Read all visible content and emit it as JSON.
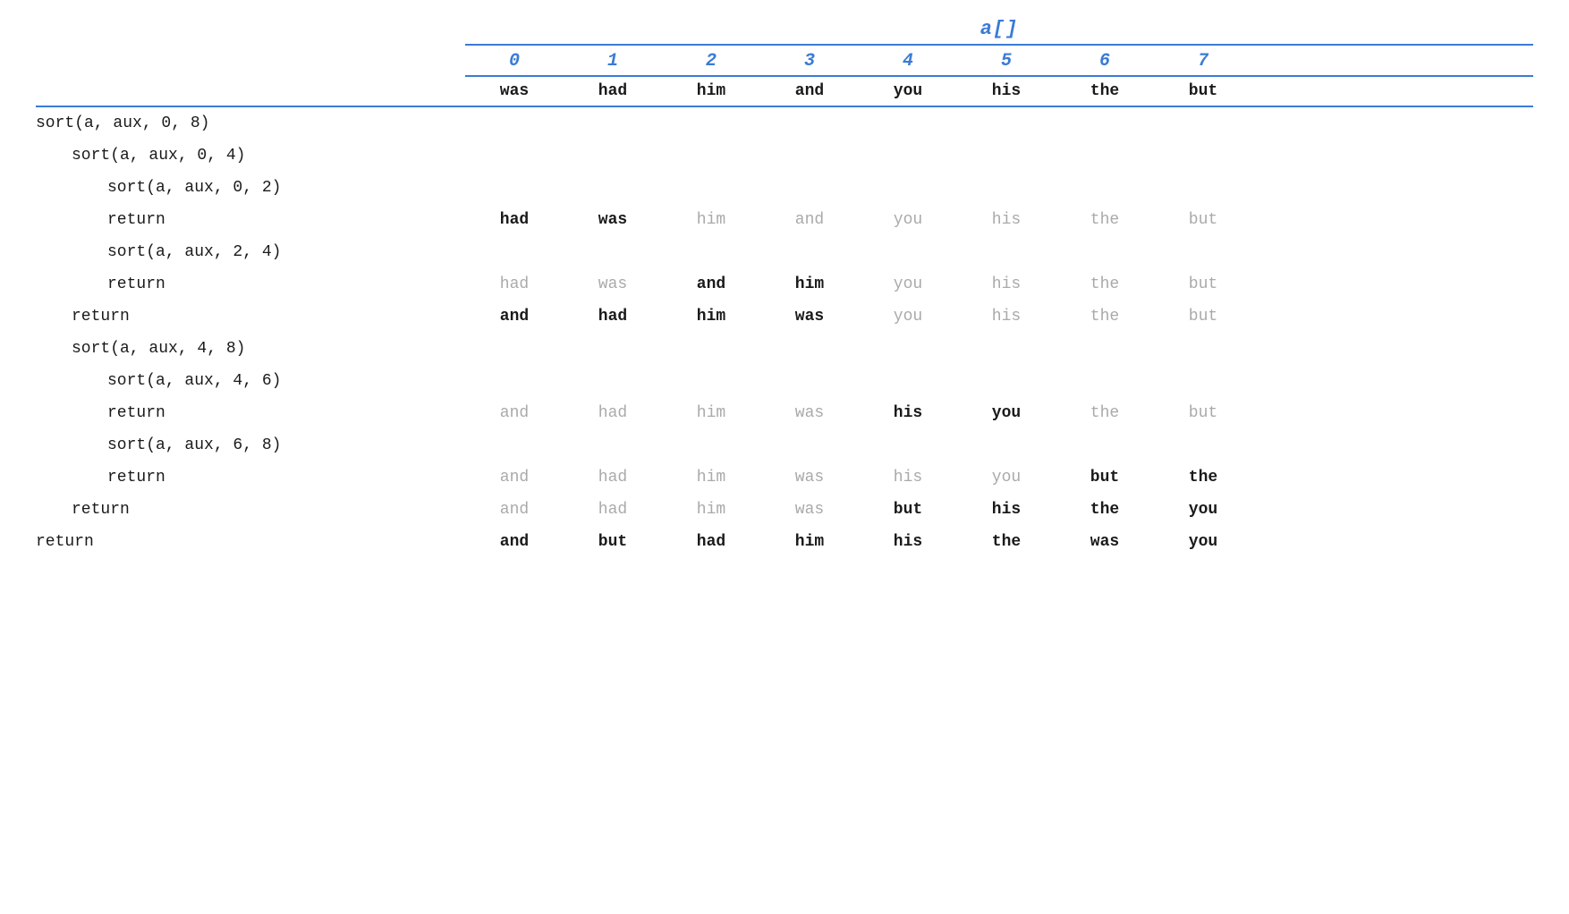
{
  "array_label": "a[]",
  "col_indices": [
    "0",
    "1",
    "2",
    "3",
    "4",
    "5",
    "6",
    "7"
  ],
  "initial_values": [
    "was",
    "had",
    "him",
    "and",
    "you",
    "his",
    "the",
    "but"
  ],
  "rows": [
    {
      "label": "sort(a, aux, 0, 8)",
      "indent": "indent-0",
      "cells": []
    },
    {
      "label": "sort(a, aux, 0, 4)",
      "indent": "indent-1",
      "cells": []
    },
    {
      "label": "sort(a, aux, 0, 2)",
      "indent": "indent-2",
      "cells": []
    },
    {
      "label": "return",
      "indent": "indent-2",
      "cells": [
        {
          "text": "had",
          "style": "bold"
        },
        {
          "text": "was",
          "style": "bold"
        },
        {
          "text": "him",
          "style": "faded"
        },
        {
          "text": "and",
          "style": "faded"
        },
        {
          "text": "you",
          "style": "faded"
        },
        {
          "text": "his",
          "style": "faded"
        },
        {
          "text": "the",
          "style": "faded"
        },
        {
          "text": "but",
          "style": "faded"
        }
      ]
    },
    {
      "label": "sort(a, aux, 2, 4)",
      "indent": "indent-2",
      "cells": []
    },
    {
      "label": "return",
      "indent": "indent-2",
      "cells": [
        {
          "text": "had",
          "style": "faded"
        },
        {
          "text": "was",
          "style": "faded"
        },
        {
          "text": "and",
          "style": "bold"
        },
        {
          "text": "him",
          "style": "bold"
        },
        {
          "text": "you",
          "style": "faded"
        },
        {
          "text": "his",
          "style": "faded"
        },
        {
          "text": "the",
          "style": "faded"
        },
        {
          "text": "but",
          "style": "faded"
        }
      ]
    },
    {
      "label": "return",
      "indent": "indent-1",
      "cells": [
        {
          "text": "and",
          "style": "bold"
        },
        {
          "text": "had",
          "style": "bold"
        },
        {
          "text": "him",
          "style": "bold"
        },
        {
          "text": "was",
          "style": "bold"
        },
        {
          "text": "you",
          "style": "faded"
        },
        {
          "text": "his",
          "style": "faded"
        },
        {
          "text": "the",
          "style": "faded"
        },
        {
          "text": "but",
          "style": "faded"
        }
      ]
    },
    {
      "label": "sort(a, aux, 4, 8)",
      "indent": "indent-1",
      "cells": []
    },
    {
      "label": "sort(a, aux, 4, 6)",
      "indent": "indent-2",
      "cells": []
    },
    {
      "label": "return",
      "indent": "indent-2",
      "cells": [
        {
          "text": "and",
          "style": "faded"
        },
        {
          "text": "had",
          "style": "faded"
        },
        {
          "text": "him",
          "style": "faded"
        },
        {
          "text": "was",
          "style": "faded"
        },
        {
          "text": "his",
          "style": "bold"
        },
        {
          "text": "you",
          "style": "bold"
        },
        {
          "text": "the",
          "style": "faded"
        },
        {
          "text": "but",
          "style": "faded"
        }
      ]
    },
    {
      "label": "sort(a, aux, 6, 8)",
      "indent": "indent-2",
      "cells": []
    },
    {
      "label": "return",
      "indent": "indent-2",
      "cells": [
        {
          "text": "and",
          "style": "faded"
        },
        {
          "text": "had",
          "style": "faded"
        },
        {
          "text": "him",
          "style": "faded"
        },
        {
          "text": "was",
          "style": "faded"
        },
        {
          "text": "his",
          "style": "faded"
        },
        {
          "text": "you",
          "style": "faded"
        },
        {
          "text": "but",
          "style": "bold"
        },
        {
          "text": "the",
          "style": "bold"
        }
      ]
    },
    {
      "label": "return",
      "indent": "indent-1",
      "cells": [
        {
          "text": "and",
          "style": "faded"
        },
        {
          "text": "had",
          "style": "faded"
        },
        {
          "text": "him",
          "style": "faded"
        },
        {
          "text": "was",
          "style": "faded"
        },
        {
          "text": "but",
          "style": "bold"
        },
        {
          "text": "his",
          "style": "bold"
        },
        {
          "text": "the",
          "style": "bold"
        },
        {
          "text": "you",
          "style": "bold"
        }
      ]
    },
    {
      "label": "return",
      "indent": "indent-0",
      "cells": [
        {
          "text": "and",
          "style": "bold"
        },
        {
          "text": "but",
          "style": "bold"
        },
        {
          "text": "had",
          "style": "bold"
        },
        {
          "text": "him",
          "style": "bold"
        },
        {
          "text": "his",
          "style": "bold"
        },
        {
          "text": "the",
          "style": "bold"
        },
        {
          "text": "was",
          "style": "bold"
        },
        {
          "text": "you",
          "style": "bold"
        }
      ]
    }
  ]
}
